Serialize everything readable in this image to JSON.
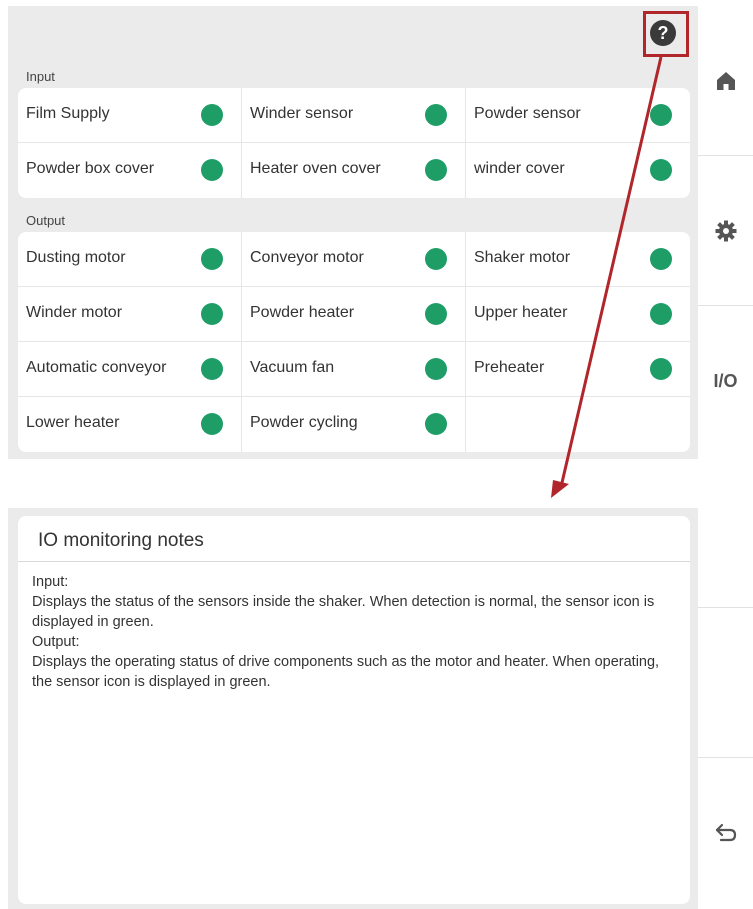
{
  "sections": {
    "input_label": "Input",
    "output_label": "Output"
  },
  "inputs": [
    {
      "label": "Film Supply",
      "status": "on"
    },
    {
      "label": "Winder sensor",
      "status": "on"
    },
    {
      "label": "Powder sensor",
      "status": "on"
    },
    {
      "label": "Powder box cover",
      "status": "on"
    },
    {
      "label": "Heater oven cover",
      "status": "on"
    },
    {
      "label": "winder cover",
      "status": "on"
    }
  ],
  "outputs": [
    {
      "label": "Dusting motor",
      "status": "on"
    },
    {
      "label": "Conveyor motor",
      "status": "on"
    },
    {
      "label": "Shaker motor",
      "status": "on"
    },
    {
      "label": "Winder motor",
      "status": "on"
    },
    {
      "label": "Powder heater",
      "status": "on"
    },
    {
      "label": "Upper heater",
      "status": "on"
    },
    {
      "label": "Automatic conveyor",
      "status": "on"
    },
    {
      "label": "Vacuum fan",
      "status": "on"
    },
    {
      "label": "Preheater",
      "status": "on"
    },
    {
      "label": "Lower heater",
      "status": "on"
    },
    {
      "label": "Powder cycling",
      "status": "on"
    }
  ],
  "side_nav": {
    "home_icon": "home-icon",
    "settings_icon": "gear-icon",
    "io_label": "I/O",
    "back_icon": "back-arrow-icon"
  },
  "help_icon": "question-circle-icon",
  "notes": {
    "title": "IO monitoring notes",
    "lines": [
      "Input:",
      "Displays the status of the sensors inside the shaker. When detection is normal, the sensor icon is displayed in green.",
      "Output:",
      "Displays the operating status of drive components such as the motor and heater. When operating, the sensor icon is displayed in green."
    ]
  },
  "colors": {
    "status_on": "#1f9d67",
    "annotation": "#b1262a",
    "background": "#ebebeb"
  }
}
